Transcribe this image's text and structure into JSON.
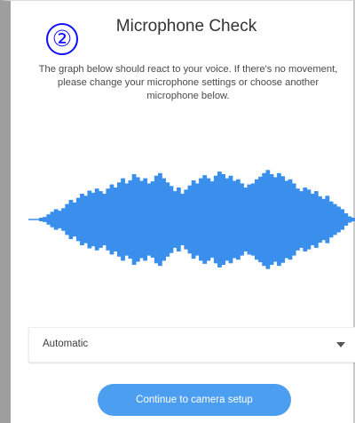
{
  "step_badge": "②",
  "dialog": {
    "title": "Microphone Check",
    "instructions": {
      "line1": "The graph below should react to your voice. If there's no movement,",
      "line2": "please change your microphone settings or choose another",
      "line3": "microphone below."
    }
  },
  "microphone_select": {
    "selected": "Automatic",
    "icon": "chevron-down-icon"
  },
  "continue_button": {
    "label": "Continue to camera setup"
  },
  "colors": {
    "accent": "#4c9ff0",
    "waveform": "#3a8fec",
    "badge": "#1010ff"
  },
  "waveform": {
    "amplitudes": [
      0.02,
      0.05,
      0.1,
      0.15,
      0.2,
      0.17,
      0.22,
      0.3,
      0.38,
      0.33,
      0.42,
      0.5,
      0.46,
      0.56,
      0.52,
      0.6,
      0.55,
      0.5,
      0.6,
      0.68,
      0.62,
      0.72,
      0.8,
      0.7,
      0.76,
      0.88,
      0.82,
      0.75,
      0.8,
      0.7,
      0.74,
      0.85,
      0.9,
      0.8,
      0.72,
      0.65,
      0.55,
      0.62,
      0.5,
      0.58,
      0.66,
      0.76,
      0.7,
      0.8,
      0.86,
      0.8,
      0.74,
      0.85,
      0.93,
      0.88,
      0.8,
      0.85,
      0.75,
      0.78,
      0.7,
      0.62,
      0.68,
      0.7,
      0.78,
      0.83,
      0.9,
      0.96,
      0.88,
      0.82,
      0.9,
      0.84,
      0.75,
      0.78,
      0.7,
      0.6,
      0.55,
      0.62,
      0.58,
      0.5,
      0.55,
      0.45,
      0.4,
      0.46,
      0.35,
      0.3,
      0.25,
      0.2,
      0.12,
      0.06,
      0.03
    ]
  }
}
